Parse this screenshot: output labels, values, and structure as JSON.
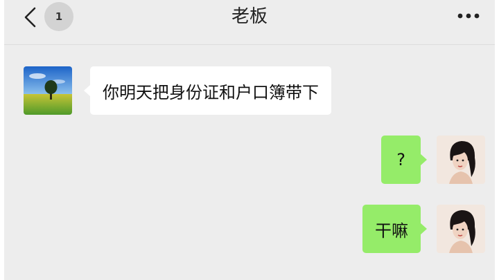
{
  "header": {
    "title": "老板",
    "unread_count": "1",
    "back_icon": "chevron-left-icon",
    "more_icon": "more-dots-icon"
  },
  "messages": [
    {
      "side": "left",
      "text": "你明天把身份证和户口簿带下",
      "avatar": "landscape-tree-avatar"
    },
    {
      "side": "right",
      "text": "?",
      "avatar": "woman-portrait-avatar"
    },
    {
      "side": "right",
      "text": "干嘛",
      "avatar": "woman-portrait-avatar"
    }
  ],
  "colors": {
    "background": "#ededed",
    "sent_bubble": "#95ec69",
    "received_bubble": "#ffffff"
  }
}
